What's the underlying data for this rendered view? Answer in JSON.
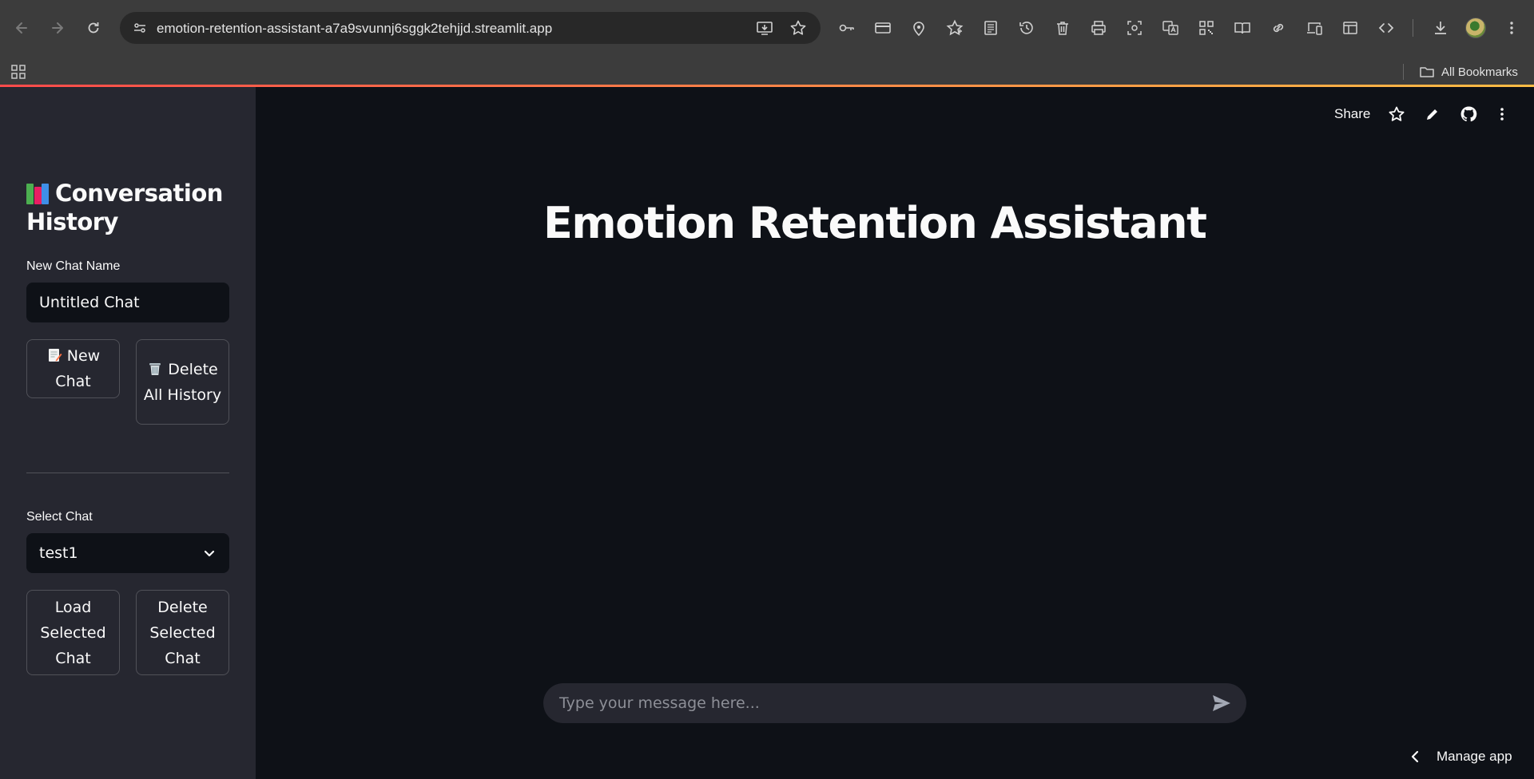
{
  "browser": {
    "url": "emotion-retention-assistant-a7a9svunnj6sggk2tehjjd.streamlit.app",
    "bookmarks_label": "All Bookmarks"
  },
  "header": {
    "share_label": "Share"
  },
  "sidebar": {
    "title": "Conversation History",
    "title_icon": "books-icon",
    "new_chat_name_label": "New Chat Name",
    "new_chat_name_value": "Untitled Chat",
    "new_chat_button": "New Chat",
    "new_chat_icon": "memo-icon",
    "delete_all_button": "Delete All History",
    "delete_all_icon": "wastebasket-icon",
    "select_chat_label": "Select Chat",
    "select_chat_value": "test1",
    "load_selected_button": "Load Selected Chat",
    "delete_selected_button": "Delete Selected Chat"
  },
  "main": {
    "title": "Emotion Retention Assistant",
    "chat_placeholder": "Type your message here..."
  },
  "footer": {
    "manage_app_label": "Manage app"
  },
  "colors": {
    "app_background": "#0e1117",
    "sidebar_background": "#262730",
    "accent_start": "#ff4b4b",
    "accent_end": "#ffbd45"
  }
}
